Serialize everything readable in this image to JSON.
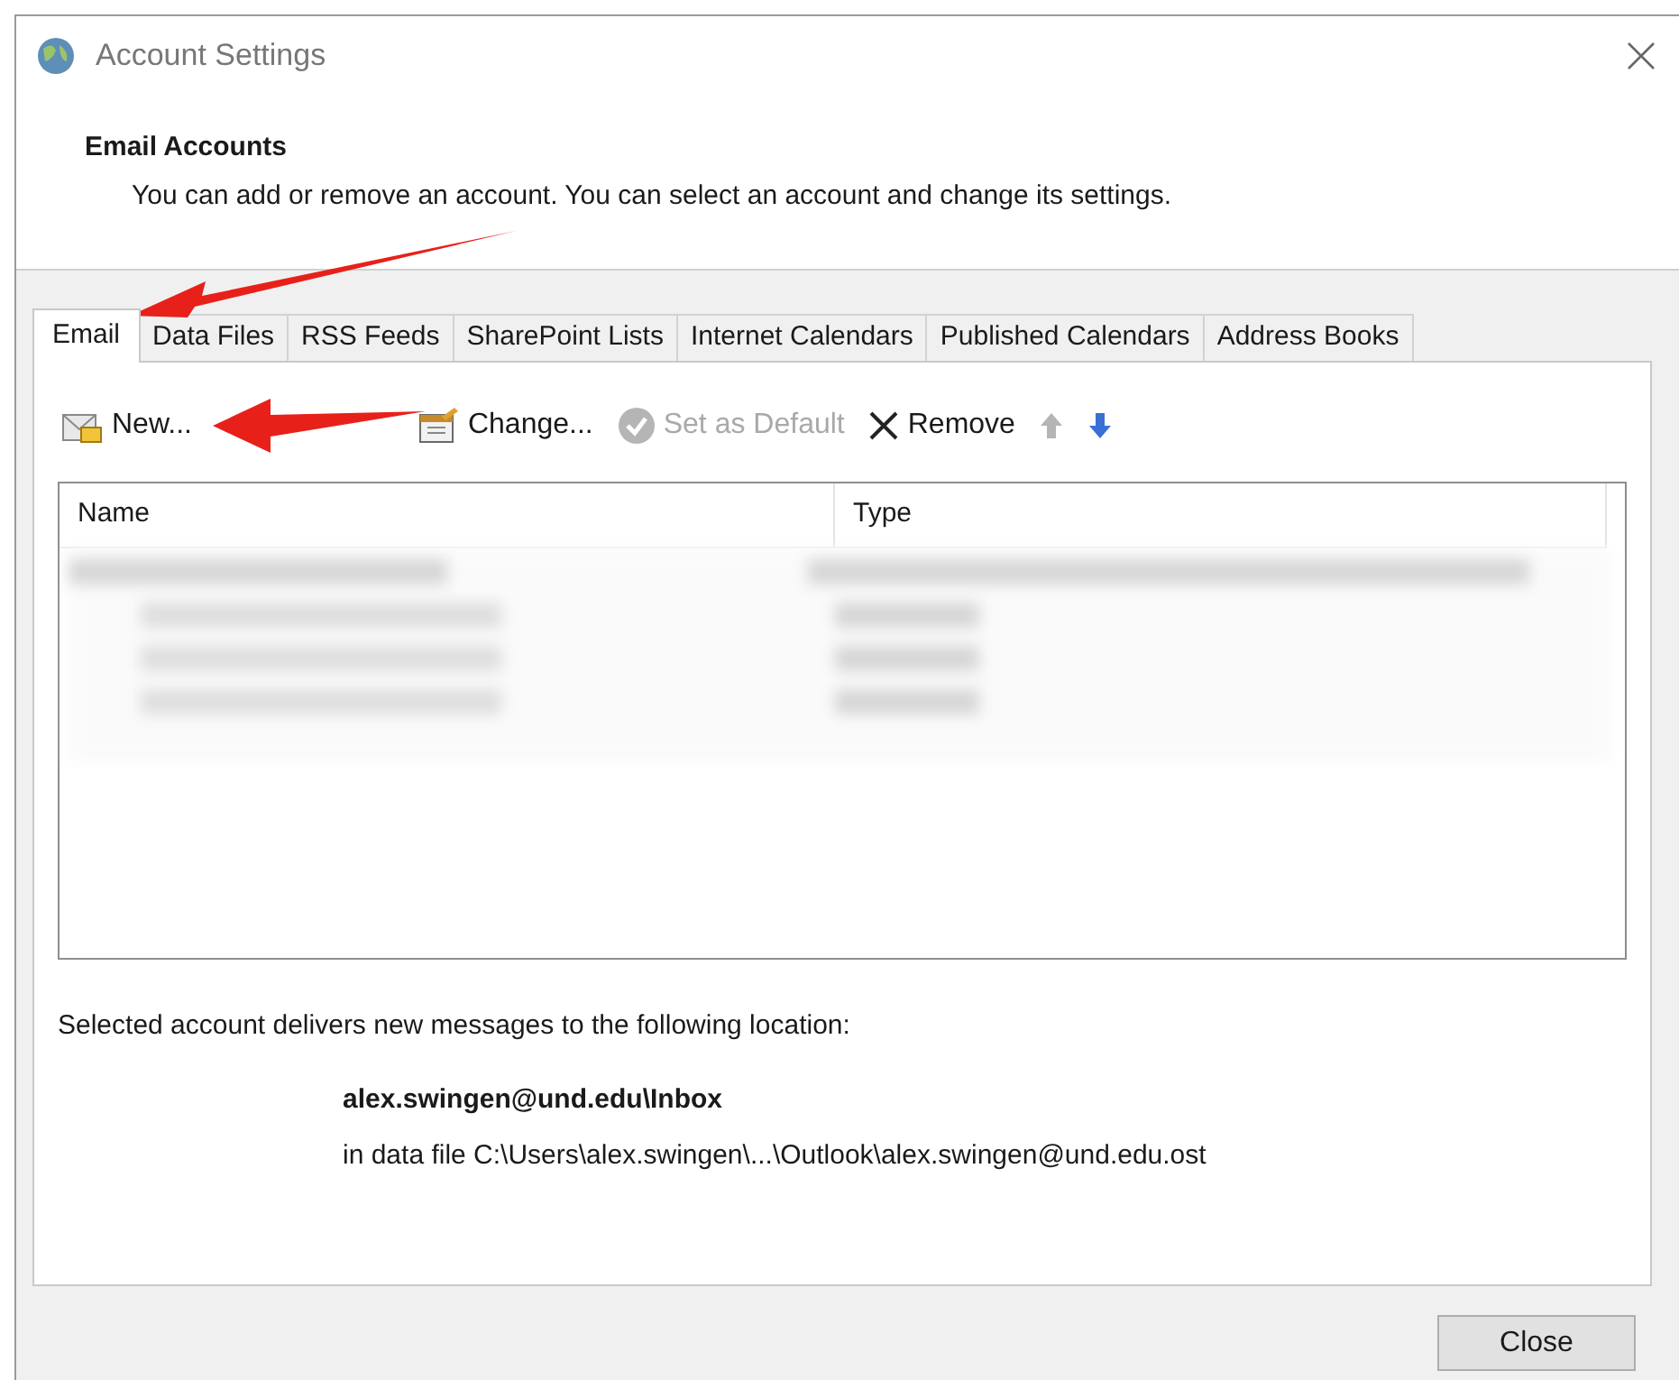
{
  "window": {
    "title": "Account Settings"
  },
  "header": {
    "title": "Email Accounts",
    "description": "You can add or remove an account. You can select an account and change its settings."
  },
  "tabs": [
    {
      "label": "Email",
      "selected": true
    },
    {
      "label": "Data Files",
      "selected": false
    },
    {
      "label": "RSS Feeds",
      "selected": false
    },
    {
      "label": "SharePoint Lists",
      "selected": false
    },
    {
      "label": "Internet Calendars",
      "selected": false
    },
    {
      "label": "Published Calendars",
      "selected": false
    },
    {
      "label": "Address Books",
      "selected": false
    }
  ],
  "toolbar": [
    {
      "kind": "new",
      "label": "New...",
      "disabled": false
    },
    {
      "kind": "change",
      "label": "Change...",
      "disabled": false
    },
    {
      "kind": "default",
      "label": "Set as Default",
      "disabled": true
    },
    {
      "kind": "remove",
      "label": "Remove",
      "disabled": false
    },
    {
      "kind": "up",
      "disabled": true
    },
    {
      "kind": "down",
      "disabled": false
    }
  ],
  "table": {
    "columns": [
      "Name",
      "Type"
    ]
  },
  "location": {
    "intro": "Selected account delivers new messages to the following location:",
    "folder": "alex.swingen@und.edu\\Inbox",
    "data_file": "in data file C:\\Users\\alex.swingen\\...\\Outlook\\alex.swingen@und.edu.ost"
  },
  "buttons": [
    "Close"
  ]
}
